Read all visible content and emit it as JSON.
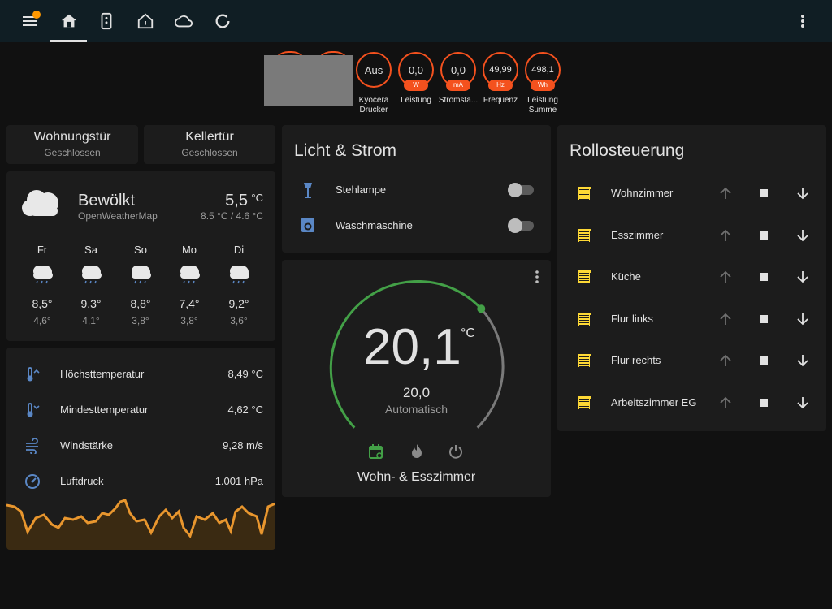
{
  "header": {
    "tabs": [
      {
        "icon": "home-icon"
      },
      {
        "icon": "remote-icon"
      },
      {
        "icon": "home-outline-icon"
      },
      {
        "icon": "cloud-icon"
      },
      {
        "icon": "loading-circle-icon"
      }
    ]
  },
  "badges": [
    {
      "value": "Aus",
      "unit": "",
      "label": "Kyocera Drucker"
    },
    {
      "value": "0,0",
      "unit": "W",
      "label": "Leistung"
    },
    {
      "value": "0,0",
      "unit": "mA",
      "label": "Stromstä..."
    },
    {
      "value": "49,99",
      "unit": "Hz",
      "label": "Frequenz"
    },
    {
      "value": "498,1",
      "unit": "Wh",
      "label": "Leistung Summe"
    }
  ],
  "doors": [
    {
      "name": "Wohnungstür",
      "state": "Geschlossen"
    },
    {
      "name": "Kellertür",
      "state": "Geschlossen"
    }
  ],
  "weather": {
    "condition": "Bewölkt",
    "source": "OpenWeatherMap",
    "temperature": "5,5",
    "unit": "°C",
    "range": "8.5 °C / 4.6 °C",
    "forecast": [
      {
        "day": "Fr",
        "high": "8,5°",
        "low": "4,6°"
      },
      {
        "day": "Sa",
        "high": "9,3°",
        "low": "4,1°"
      },
      {
        "day": "So",
        "high": "8,8°",
        "low": "3,8°"
      },
      {
        "day": "Mo",
        "high": "7,4°",
        "low": "3,8°"
      },
      {
        "day": "Di",
        "high": "9,2°",
        "low": "3,6°"
      }
    ]
  },
  "sensors": [
    {
      "label": "Höchsttemperatur",
      "value": "8,49 °C"
    },
    {
      "label": "Mindesttemperatur",
      "value": "4,62 °C"
    },
    {
      "label": "Windstärke",
      "value": "9,28 m/s"
    },
    {
      "label": "Luftdruck",
      "value": "1.001 hPa"
    }
  ],
  "lights": {
    "title": "Licht & Strom",
    "items": [
      {
        "label": "Stehlampe",
        "state": "off"
      },
      {
        "label": "Waschmaschine",
        "state": "off"
      }
    ]
  },
  "thermostat": {
    "current": "20,1",
    "unit": "°C",
    "target": "20,0",
    "mode": "Automatisch",
    "name": "Wohn- & Esszimmer",
    "current_fraction": 0.68
  },
  "covers": {
    "title": "Rollosteuerung",
    "items": [
      {
        "label": "Wohnzimmer"
      },
      {
        "label": "Esszimmer"
      },
      {
        "label": "Küche"
      },
      {
        "label": "Flur links"
      },
      {
        "label": "Flur rechts"
      },
      {
        "label": "Arbeitszimmer EG"
      }
    ]
  },
  "colors": {
    "header_bg": "#101e24",
    "card_bg": "#1c1c1c",
    "badge_accent": "#f4511e",
    "cover_icon": "#fdd835",
    "heat_green": "#43a047",
    "graph": "#e8962e"
  }
}
